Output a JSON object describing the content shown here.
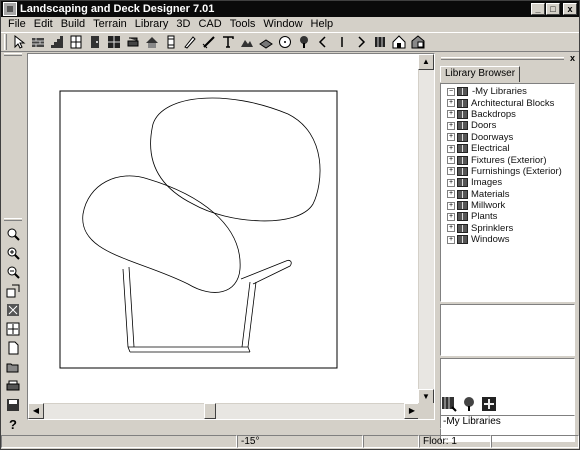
{
  "window": {
    "title": "Landscaping and Deck Designer 7.01",
    "buttons": {
      "minimize": "_",
      "maximize": "□",
      "close": "x"
    }
  },
  "menu": [
    "File",
    "Edit",
    "Build",
    "Terrain",
    "Library",
    "3D",
    "CAD",
    "Tools",
    "Window",
    "Help"
  ],
  "toolbar": [
    "select-arrow-icon",
    "wall-icon",
    "stair-icon",
    "cabinet-icon",
    "door-icon",
    "window-icon",
    "furniture-icon",
    "roof-icon",
    "column-icon",
    "survey-icon",
    "dimension-icon",
    "text-tool-icon",
    "terrain-icon",
    "deck-icon",
    "circle-icon",
    "plant-icon",
    "arrow-left-icon",
    "marker-icon",
    "arrow-right-icon",
    "column-icon",
    "house-icon",
    "render-icon"
  ],
  "left_tools": [
    "zoom-icon",
    "zoom-in-icon",
    "zoom-out-icon",
    "undo-zoom-icon",
    "fill-window-icon",
    "fit-icon",
    "new-file-icon",
    "open-file-icon",
    "print-icon",
    "save-icon",
    "help-icon"
  ],
  "canvas": {
    "angle": "-15°",
    "floor": "Floor: 1"
  },
  "library": {
    "tab": "Library Browser",
    "close": "x",
    "items": [
      {
        "label": "-My Libraries",
        "root": true
      },
      {
        "label": "Architectural Blocks"
      },
      {
        "label": "Backdrops"
      },
      {
        "label": "Doors"
      },
      {
        "label": "Doorways"
      },
      {
        "label": "Electrical"
      },
      {
        "label": "Fixtures (Exterior)"
      },
      {
        "label": "Furnishings (Exterior)"
      },
      {
        "label": "Images"
      },
      {
        "label": "Materials"
      },
      {
        "label": "Millwork"
      },
      {
        "label": "Plants"
      },
      {
        "label": "Sprinklers"
      },
      {
        "label": "Windows"
      }
    ],
    "status": "-My Libraries"
  },
  "colors": {
    "title_bg": "#0a0a0a",
    "chrome": "#d4d0c8",
    "canvas": "#ffffff"
  }
}
